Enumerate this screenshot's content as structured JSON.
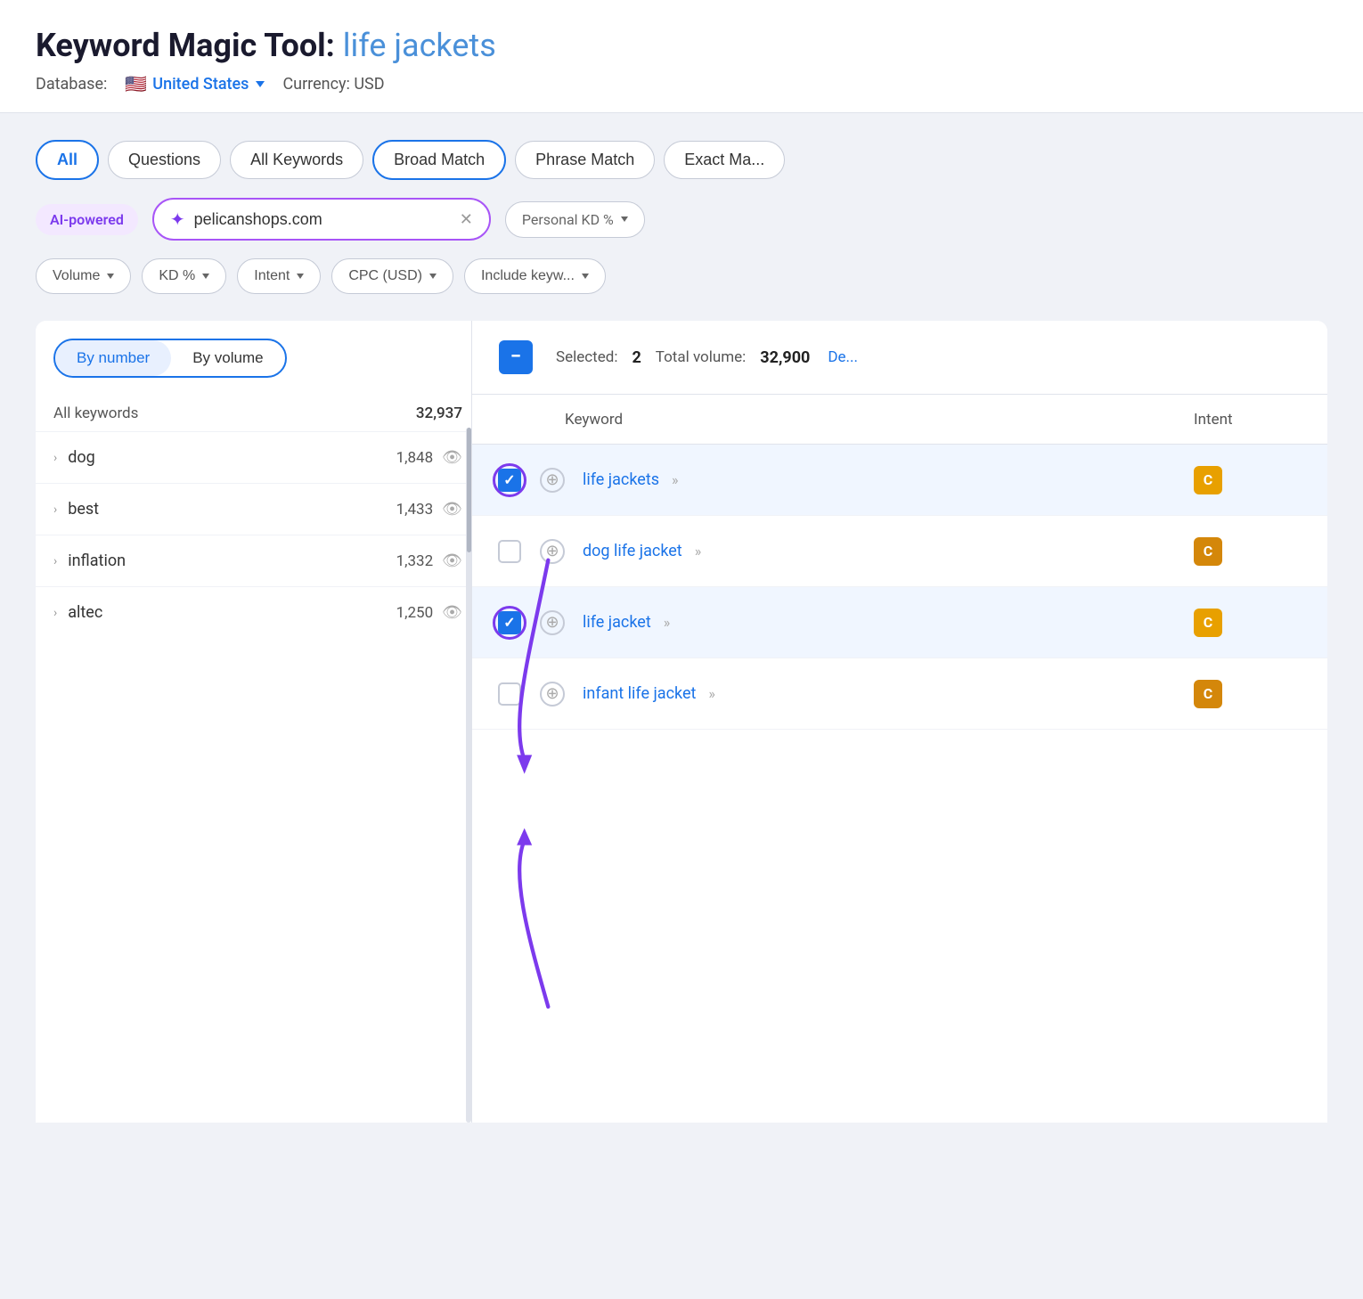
{
  "header": {
    "title_static": "Keyword Magic Tool:",
    "title_keyword": "life jackets",
    "database_label": "Database:",
    "country": "United States",
    "currency_label": "Currency: USD"
  },
  "filter_tabs": [
    {
      "id": "all",
      "label": "All",
      "active": true,
      "style": "active-blue"
    },
    {
      "id": "questions",
      "label": "Questions",
      "active": false
    },
    {
      "id": "all-keywords",
      "label": "All Keywords",
      "active": false
    },
    {
      "id": "broad-match",
      "label": "Broad Match",
      "active": true,
      "style": "active-selected"
    },
    {
      "id": "phrase-match",
      "label": "Phrase Match",
      "active": false
    },
    {
      "id": "exact-match",
      "label": "Exact Ma...",
      "active": false
    }
  ],
  "ai_input": {
    "badge_label": "AI-powered",
    "placeholder": "pelicanshops.com",
    "value": "pelicanshops.com"
  },
  "personal_kd": {
    "label": "Personal KD %"
  },
  "filter_dropdowns": [
    {
      "label": "Volume"
    },
    {
      "label": "KD %"
    },
    {
      "label": "Intent"
    },
    {
      "label": "CPC (USD)"
    },
    {
      "label": "Include keyw..."
    }
  ],
  "sort_toggle": {
    "by_number": "By number",
    "by_volume": "By volume",
    "active": "by_number"
  },
  "sidebar": {
    "header": {
      "label": "All keywords",
      "count": "32,937"
    },
    "items": [
      {
        "label": "dog",
        "count": "1,848",
        "expandable": true
      },
      {
        "label": "best",
        "count": "1,433",
        "expandable": true
      },
      {
        "label": "inflation",
        "count": "1,332",
        "expandable": true
      },
      {
        "label": "altec",
        "count": "1,250",
        "expandable": true
      }
    ]
  },
  "right_panel": {
    "selected_label": "Selected:",
    "selected_count": "2",
    "total_label": "Total volume:",
    "total_count": "32,900",
    "deselect_label": "De...",
    "keyword_col": "Keyword",
    "intent_col": "Intent",
    "rows": [
      {
        "id": "life-jackets",
        "keyword": "life jackets",
        "checked": true,
        "intent": "C",
        "intent_style": "orange",
        "selected_row": true,
        "annotated": true
      },
      {
        "id": "dog-life-jacket",
        "keyword": "dog life jacket",
        "checked": false,
        "intent": "C",
        "intent_style": "gold",
        "selected_row": false,
        "annotated": false
      },
      {
        "id": "life-jacket",
        "keyword": "life jacket",
        "checked": true,
        "intent": "C",
        "intent_style": "orange",
        "selected_row": true,
        "annotated": true
      },
      {
        "id": "infant-life-jacket",
        "keyword": "infant life jacket",
        "checked": false,
        "intent": "C",
        "intent_style": "gold",
        "selected_row": false,
        "annotated": false
      }
    ]
  },
  "arrows": {
    "top_arrow_label": "arrow pointing down to life jackets row",
    "bottom_arrow_label": "arrow pointing up to life jacket row"
  }
}
